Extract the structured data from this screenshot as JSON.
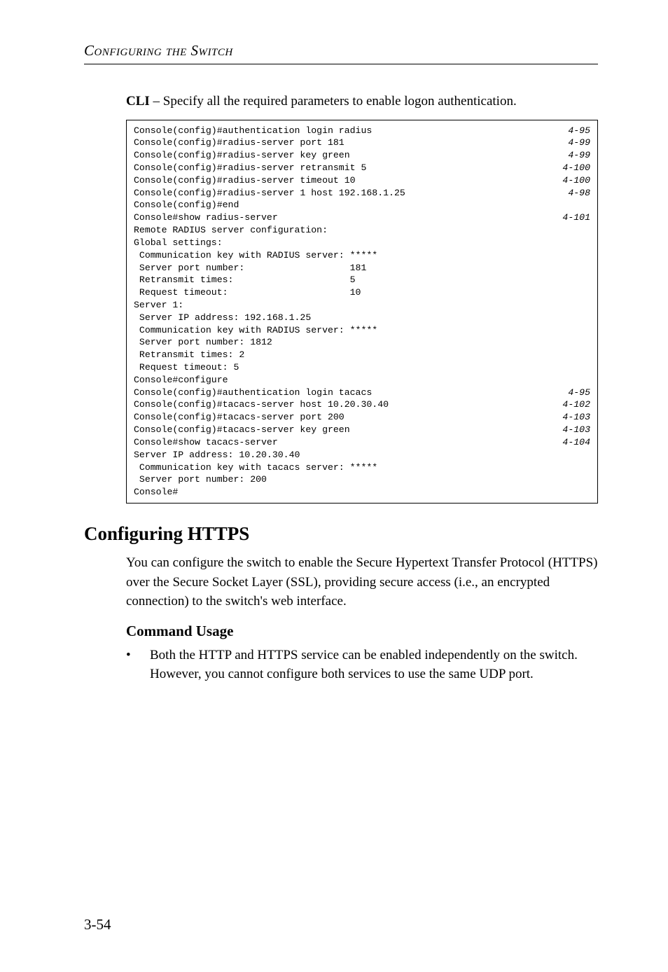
{
  "header": {
    "title": "Configuring the Switch"
  },
  "intro": {
    "bold": "CLI",
    "rest": " – Specify all the required parameters to enable logon authentication."
  },
  "code": {
    "lines": [
      {
        "text": "Console(config)#authentication login radius",
        "ref": "4-95"
      },
      {
        "text": "Console(config)#radius-server port 181",
        "ref": "4-99"
      },
      {
        "text": "Console(config)#radius-server key green",
        "ref": "4-99"
      },
      {
        "text": "Console(config)#radius-server retransmit 5",
        "ref": "4-100"
      },
      {
        "text": "Console(config)#radius-server timeout 10",
        "ref": "4-100"
      },
      {
        "text": "Console(config)#radius-server 1 host 192.168.1.25",
        "ref": "4-98"
      },
      {
        "text": "Console(config)#end",
        "ref": ""
      },
      {
        "text": "Console#show radius-server",
        "ref": "4-101"
      },
      {
        "text": "",
        "ref": ""
      },
      {
        "text": "Remote RADIUS server configuration:",
        "ref": ""
      },
      {
        "text": "",
        "ref": ""
      },
      {
        "text": "Global settings:",
        "ref": ""
      },
      {
        "text": " Communication key with RADIUS server: *****",
        "ref": ""
      },
      {
        "text": " Server port number:                   181",
        "ref": ""
      },
      {
        "text": " Retransmit times:                     5",
        "ref": ""
      },
      {
        "text": " Request timeout:                      10",
        "ref": ""
      },
      {
        "text": "",
        "ref": ""
      },
      {
        "text": "Server 1:",
        "ref": ""
      },
      {
        "text": " Server IP address: 192.168.1.25",
        "ref": ""
      },
      {
        "text": " Communication key with RADIUS server: *****",
        "ref": ""
      },
      {
        "text": " Server port number: 1812",
        "ref": ""
      },
      {
        "text": " Retransmit times: 2",
        "ref": ""
      },
      {
        "text": " Request timeout: 5",
        "ref": ""
      },
      {
        "text": "",
        "ref": ""
      },
      {
        "text": "Console#configure",
        "ref": ""
      },
      {
        "text": "Console(config)#authentication login tacacs",
        "ref": "4-95"
      },
      {
        "text": "Console(config)#tacacs-server host 10.20.30.40",
        "ref": "4-102"
      },
      {
        "text": "Console(config)#tacacs-server port 200",
        "ref": "4-103"
      },
      {
        "text": "Console(config)#tacacs-server key green",
        "ref": "4-103"
      },
      {
        "text": "Console#show tacacs-server",
        "ref": "4-104"
      },
      {
        "text": "Server IP address: 10.20.30.40",
        "ref": ""
      },
      {
        "text": " Communication key with tacacs server: *****",
        "ref": ""
      },
      {
        "text": " Server port number: 200",
        "ref": ""
      },
      {
        "text": "Console#",
        "ref": ""
      }
    ]
  },
  "section": {
    "heading": "Configuring HTTPS",
    "para": "You can configure the switch to enable the Secure Hypertext Transfer Protocol (HTTPS) over the Secure Socket Layer (SSL), providing secure access (i.e., an encrypted connection) to the switch's web interface.",
    "subheading": "Command Usage",
    "bullet": "Both the HTTP and HTTPS service can be enabled independently on the switch. However, you cannot configure both services to use the same UDP port."
  },
  "pagenum": "3-54"
}
